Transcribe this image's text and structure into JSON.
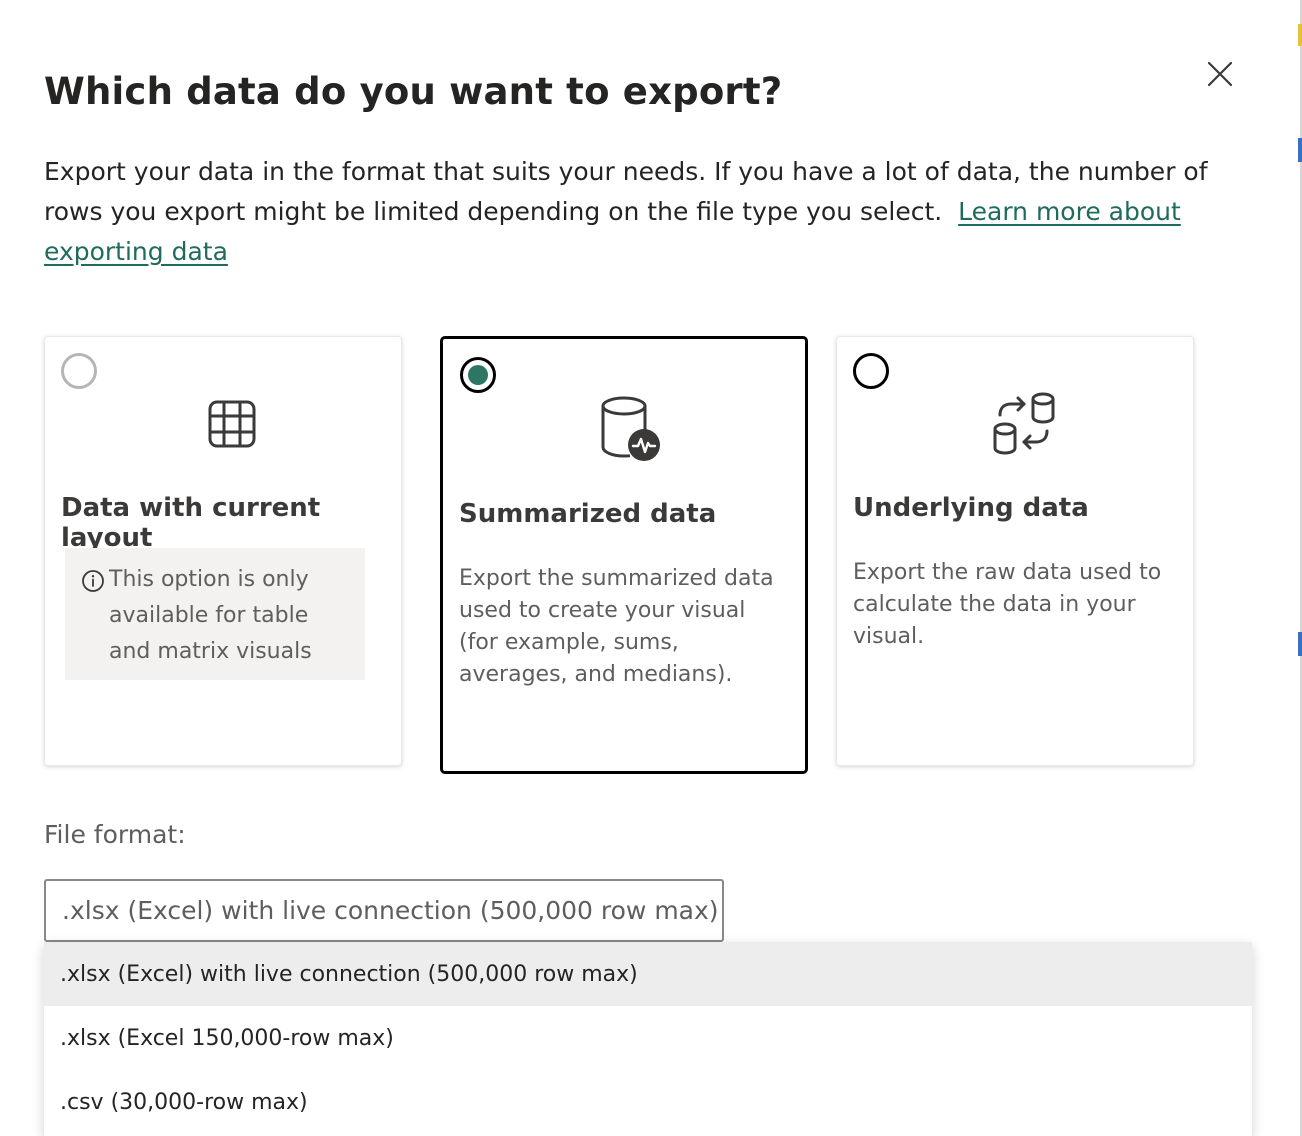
{
  "dialog": {
    "title": "Which data do you want to export?",
    "description": "Export your data in the format that suits your needs. If you have a lot of data, the number of rows you export might be limited depending on the file type you select.",
    "learn_more_link": "Learn more about exporting data"
  },
  "options": [
    {
      "title": "Data with current layout",
      "selected": false,
      "disabled": true,
      "icon": "table-grid-icon",
      "info": "This option is only available for table and matrix visuals"
    },
    {
      "title": "Summarized data",
      "selected": true,
      "disabled": false,
      "icon": "database-activity-icon",
      "description": "Export the summarized data used to create your visual (for example, sums, averages, and medians)."
    },
    {
      "title": "Underlying data",
      "selected": false,
      "disabled": false,
      "icon": "database-arrows-icon",
      "description": "Export the raw data used to calculate the data in your visual."
    }
  ],
  "file_format": {
    "label": "File format:",
    "selected": ".xlsx (Excel) with live connection (500,000 row max)",
    "options": [
      ".xlsx (Excel) with live connection (500,000 row max)",
      ".xlsx (Excel 150,000-row max)",
      ".csv (30,000-row max)"
    ]
  },
  "colors": {
    "accent": "#2e7664",
    "link": "#1f6b5d",
    "text": "#252423",
    "muted": "#605e5c"
  }
}
